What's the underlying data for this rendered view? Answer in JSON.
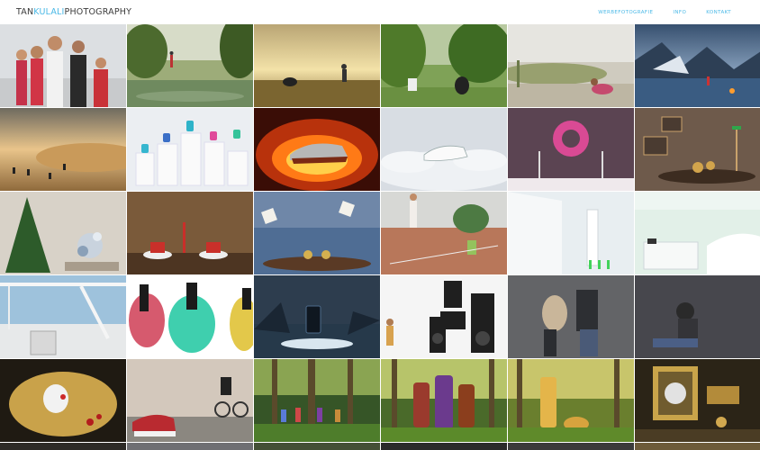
{
  "header": {
    "logo_part1": "TAN",
    "logo_part2": "KULALI",
    "logo_part3": "PHOTOGRAPHY",
    "nav": [
      "WERBEFOTOGRAFIE",
      "INFO",
      "KONTAKT"
    ]
  },
  "colors": {
    "accent": "#49b8e6",
    "text": "#3b3b3b",
    "background": "#ffffff"
  }
}
